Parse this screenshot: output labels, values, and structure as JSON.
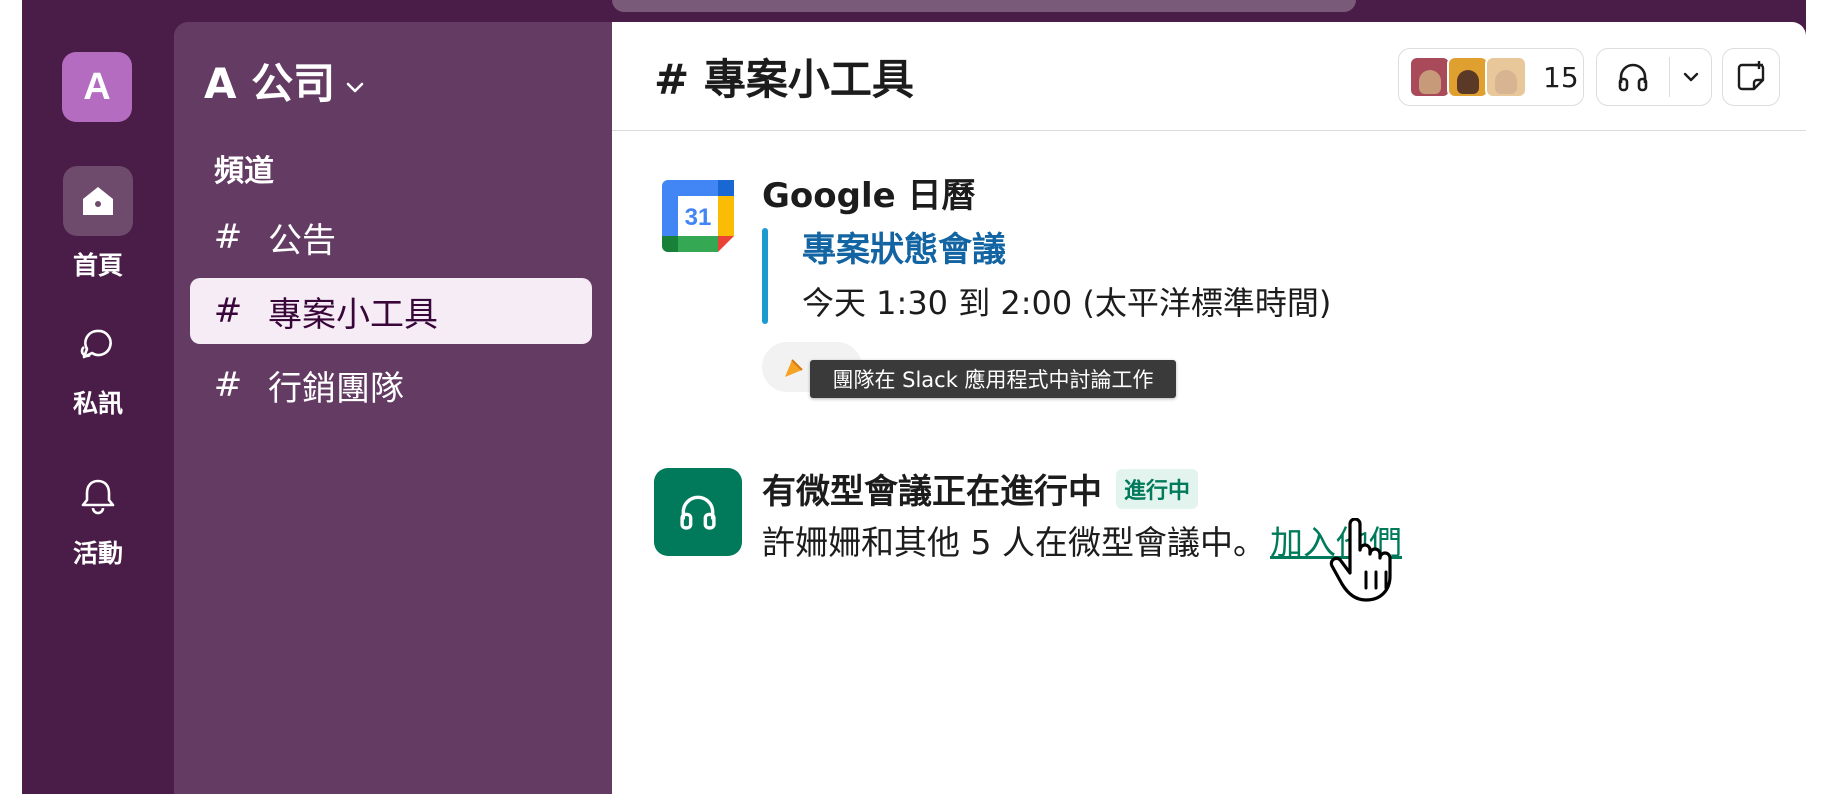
{
  "workspace": {
    "avatar_letter": "A",
    "name": "A 公司"
  },
  "rail": {
    "items": [
      {
        "label": "首頁",
        "icon": "home-icon"
      },
      {
        "label": "私訊",
        "icon": "dm-bubble-icon"
      },
      {
        "label": "活動",
        "icon": "bell-icon"
      }
    ]
  },
  "sidebar": {
    "section_title": "頻道",
    "channels": [
      {
        "hash": "#",
        "name": "公告"
      },
      {
        "hash": "#",
        "name": "專案小工具"
      },
      {
        "hash": "#",
        "name": "行銷團隊"
      }
    ]
  },
  "header": {
    "channel_title": "# 專案小工具",
    "member_count": "15"
  },
  "messages": {
    "calendar": {
      "sender": "Google 日曆",
      "calendar_day": "31",
      "event_title": "專案狀態會議",
      "event_time": "今天 1:30 到 2:00 (太平洋標準時間)",
      "tooltip": "團隊在 Slack 應用程式中討論工作"
    },
    "huddle": {
      "title": "有微型會議正在進行中",
      "badge": "進行中",
      "text": "許姍姍和其他 5 人在微型會議中。",
      "join_link": "加入他們"
    }
  },
  "colors": {
    "aubergine_dark": "#4a1c48",
    "sidebar": "#633b63",
    "active_channel": "#f6ecf6",
    "link_blue": "#1264a3",
    "huddle_green": "#007a5a"
  }
}
